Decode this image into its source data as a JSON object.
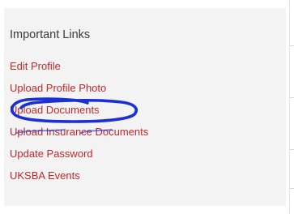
{
  "panel": {
    "title": "Important Links",
    "links": [
      {
        "label": "Edit Profile"
      },
      {
        "label": "Upload Profile Photo"
      },
      {
        "label": "Upload Documents"
      },
      {
        "label": "Upload Insurance Documents"
      },
      {
        "label": "Update Password"
      },
      {
        "label": "UKSBA Events"
      }
    ]
  },
  "annotation": {
    "type": "hand-drawn circle",
    "target": "Upload Documents",
    "color": "#1a2fd6"
  },
  "colors": {
    "panel_background": "#f3f3f3",
    "title_text": "#3a3a3a",
    "link_text": "#c0282a"
  }
}
